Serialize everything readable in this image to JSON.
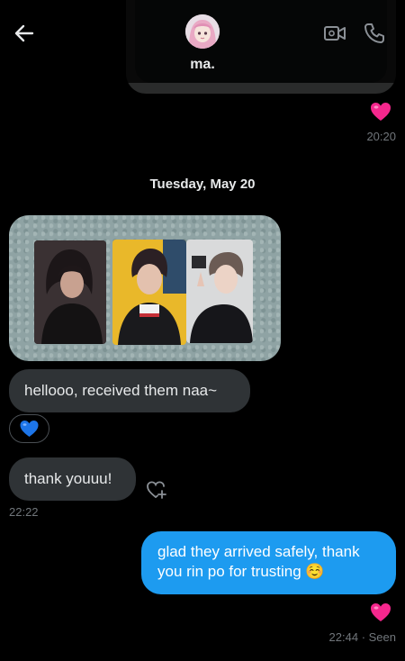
{
  "header": {
    "contact_name": "ma."
  },
  "icons": {
    "back": "arrow-left-icon",
    "video": "video-call-icon",
    "call": "phone-icon",
    "heart": "pink-heart-emoji",
    "blue_heart": "blue-heart-emoji",
    "add_reaction": "heart-plus-icon"
  },
  "colors": {
    "outgoing_bubble": "#1d9bf0",
    "incoming_bubble": "#2f3336",
    "background": "#000000"
  },
  "messages": {
    "top_time": "20:20",
    "date_separator": "Tuesday, May 20",
    "incoming_1": "hellooo, received them naa~",
    "incoming_2": "thank youuu!",
    "incoming_2_time": "22:22",
    "outgoing_1_line1": "glad they arrived safely, thank",
    "outgoing_1_line2": "you rin po for trusting ☺️",
    "outgoing_1_status": "22:44 · Seen"
  }
}
